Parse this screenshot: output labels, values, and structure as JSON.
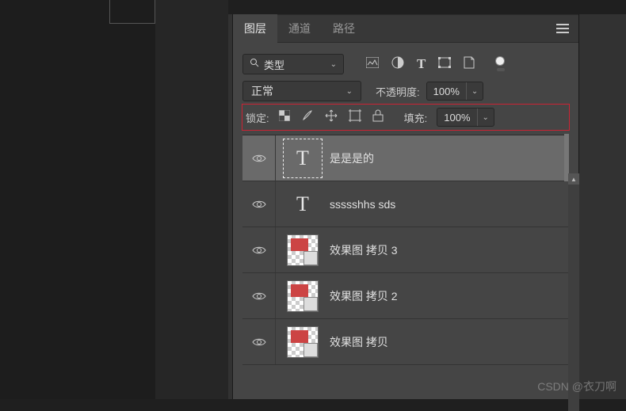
{
  "tabs": {
    "layers": "图层",
    "channels": "通道",
    "paths": "路径"
  },
  "filter": {
    "kind_label": "类型"
  },
  "blend": {
    "mode": "正常",
    "opacity_label": "不透明度:",
    "opacity_value": "100%"
  },
  "lock": {
    "label": "锁定:",
    "fill_label": "填充:",
    "fill_value": "100%"
  },
  "layers_list": [
    {
      "name": "是是是的",
      "type": "text",
      "selected": true
    },
    {
      "name": "ssssshhs sds",
      "type": "text",
      "selected": false
    },
    {
      "name": "效果图 拷贝 3",
      "type": "smart",
      "selected": false
    },
    {
      "name": "效果图 拷贝 2",
      "type": "smart",
      "selected": false
    },
    {
      "name": "效果图 拷贝",
      "type": "smart",
      "selected": false
    }
  ],
  "watermark": "CSDN @衣刀啊"
}
